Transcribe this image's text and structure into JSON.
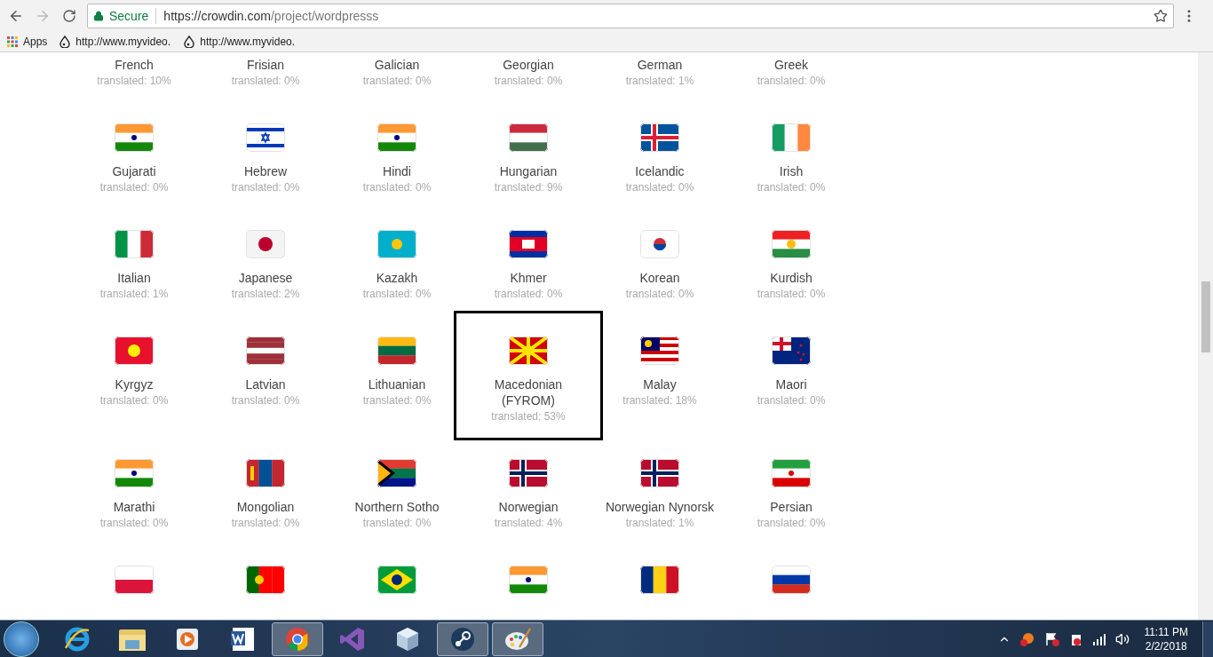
{
  "browser": {
    "secure_label": "Secure",
    "url_host": "https://crowdin.com",
    "url_path": "/project/wordpresss",
    "bookmarks": [
      {
        "label": "Apps",
        "kind": "apps"
      },
      {
        "label": "http://www.myvideo.",
        "kind": "site"
      },
      {
        "label": "http://www.myvideo.",
        "kind": "site"
      }
    ]
  },
  "languages": [
    {
      "name": "French",
      "translated": "translated: 10%",
      "kind": "text_only",
      "highlighted": false
    },
    {
      "name": "Frisian",
      "translated": "translated: 0%",
      "kind": "text_only",
      "highlighted": false
    },
    {
      "name": "Galician",
      "translated": "translated: 0%",
      "kind": "text_only",
      "highlighted": false
    },
    {
      "name": "Georgian",
      "translated": "translated: 0%",
      "kind": "text_only",
      "highlighted": false
    },
    {
      "name": "German",
      "translated": "translated: 1%",
      "kind": "text_only",
      "highlighted": false
    },
    {
      "name": "Greek",
      "translated": "translated: 0%",
      "kind": "text_only",
      "highlighted": false
    },
    {
      "name": "Gujarati",
      "translated": "translated: 0%",
      "kind": "full",
      "highlighted": false
    },
    {
      "name": "Hebrew",
      "translated": "translated: 0%",
      "kind": "full",
      "highlighted": false
    },
    {
      "name": "Hindi",
      "translated": "translated: 0%",
      "kind": "full",
      "highlighted": false
    },
    {
      "name": "Hungarian",
      "translated": "translated: 9%",
      "kind": "full",
      "highlighted": false
    },
    {
      "name": "Icelandic",
      "translated": "translated: 0%",
      "kind": "full",
      "highlighted": false
    },
    {
      "name": "Irish",
      "translated": "translated: 0%",
      "kind": "full",
      "highlighted": false
    },
    {
      "name": "Italian",
      "translated": "translated: 1%",
      "kind": "full",
      "highlighted": false
    },
    {
      "name": "Japanese",
      "translated": "translated: 2%",
      "kind": "full",
      "highlighted": false
    },
    {
      "name": "Kazakh",
      "translated": "translated: 0%",
      "kind": "full",
      "highlighted": false
    },
    {
      "name": "Khmer",
      "translated": "translated: 0%",
      "kind": "full",
      "highlighted": false
    },
    {
      "name": "Korean",
      "translated": "translated: 0%",
      "kind": "full",
      "highlighted": false
    },
    {
      "name": "Kurdish",
      "translated": "translated: 0%",
      "kind": "full",
      "highlighted": false
    },
    {
      "name": "Kyrgyz",
      "translated": "translated: 0%",
      "kind": "full",
      "highlighted": false
    },
    {
      "name": "Latvian",
      "translated": "translated: 0%",
      "kind": "full",
      "highlighted": false
    },
    {
      "name": "Lithuanian",
      "translated": "translated: 0%",
      "kind": "full",
      "highlighted": false
    },
    {
      "name": "Macedonian (FYROM)",
      "translated": "translated: 53%",
      "kind": "full",
      "highlighted": true
    },
    {
      "name": "Malay",
      "translated": "translated: 18%",
      "kind": "full",
      "highlighted": false
    },
    {
      "name": "Maori",
      "translated": "translated: 0%",
      "kind": "full",
      "highlighted": false
    },
    {
      "name": "Marathi",
      "translated": "translated: 0%",
      "kind": "full",
      "highlighted": false
    },
    {
      "name": "Mongolian",
      "translated": "translated: 0%",
      "kind": "full",
      "highlighted": false
    },
    {
      "name": "Northern Sotho",
      "translated": "translated: 0%",
      "kind": "full",
      "highlighted": false
    },
    {
      "name": "Norwegian",
      "translated": "translated: 4%",
      "kind": "full",
      "highlighted": false
    },
    {
      "name": "Norwegian Nynorsk",
      "translated": "translated: 1%",
      "kind": "full",
      "highlighted": false
    },
    {
      "name": "Persian",
      "translated": "translated: 0%",
      "kind": "full",
      "highlighted": false
    },
    {
      "kind": "flag_only"
    },
    {
      "kind": "flag_only"
    },
    {
      "kind": "flag_only"
    },
    {
      "kind": "flag_only"
    },
    {
      "kind": "flag_only"
    },
    {
      "kind": "flag_only"
    }
  ],
  "taskbar": {
    "apps": [
      {
        "kind": "ie",
        "active": false
      },
      {
        "kind": "folder",
        "active": false
      },
      {
        "kind": "media",
        "active": false
      },
      {
        "kind": "word",
        "active": false
      },
      {
        "kind": "chrome",
        "active": true
      },
      {
        "kind": "vs",
        "active": false
      },
      {
        "kind": "cube",
        "active": false
      },
      {
        "kind": "steam",
        "active": true
      },
      {
        "kind": "paint",
        "active": true
      }
    ],
    "time": "11:11 PM",
    "date": "2/2/2018"
  }
}
